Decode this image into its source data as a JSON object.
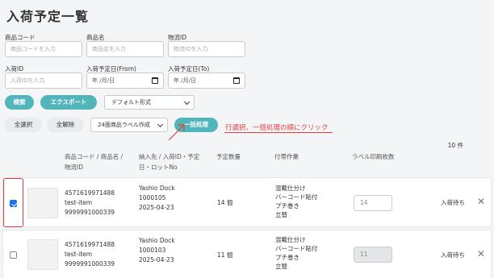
{
  "page": {
    "title": "入荷予定一覧"
  },
  "filters": {
    "product_code": {
      "label": "商品コード",
      "placeholder": "商品コードを入力"
    },
    "product_name": {
      "label": "商品名",
      "placeholder": "商品名を入力"
    },
    "logistics_id": {
      "label": "物流ID",
      "placeholder": "物流IDを入力"
    },
    "arrival_id": {
      "label": "入荷ID",
      "placeholder": "入荷IDを入力"
    },
    "date_from": {
      "label": "入荷予定日(From)",
      "value": "年 /月/日"
    },
    "date_to": {
      "label": "入荷予定日(To)",
      "value": "年 /月/日"
    }
  },
  "actions": {
    "search": "検索",
    "export": "エクスポート",
    "format_select": "デフォルト形式",
    "select_all": "全選択",
    "deselect_all": "全解除",
    "label_select": "24面商品ラベル作成",
    "batch": "一括処理"
  },
  "annotation": "行選択、一括処理の順にクリック",
  "table": {
    "count": "10 件",
    "headers": {
      "product": "商品コード / 商品名 / 物流ID",
      "dest": "納入先 / 入荷ID・予定日・ロットNo",
      "qty": "予定数量",
      "work": "付帯作業",
      "labels": "ラベル印刷枚数"
    },
    "rows": [
      {
        "checked": true,
        "code": "4571619971488",
        "name": "test-item",
        "logistics_id": "9999991000339",
        "dest": "Yashio Dock",
        "arrival_id": "1000105",
        "date": "2025-04-23",
        "qty": "14 個",
        "work": [
          "混載仕分け",
          "バーコード貼付",
          "プチ巻き",
          "立替"
        ],
        "label_count": "14",
        "status": "入荷待ち"
      },
      {
        "checked": false,
        "code": "4571619971488",
        "name": "test-item",
        "logistics_id": "9999991000339",
        "dest": "Yashio Dock",
        "arrival_id": "1000103",
        "date": "2025-04-23",
        "qty": "11 個",
        "work": [
          "混載仕分け",
          "バーコード貼付",
          "プチ巻き",
          "立替"
        ],
        "label_count": "11",
        "status": "入荷待ち"
      }
    ]
  },
  "colors": {
    "accent": "#52b5b9",
    "annotation": "#e23c3c",
    "checkbox": "#1a73e8"
  }
}
